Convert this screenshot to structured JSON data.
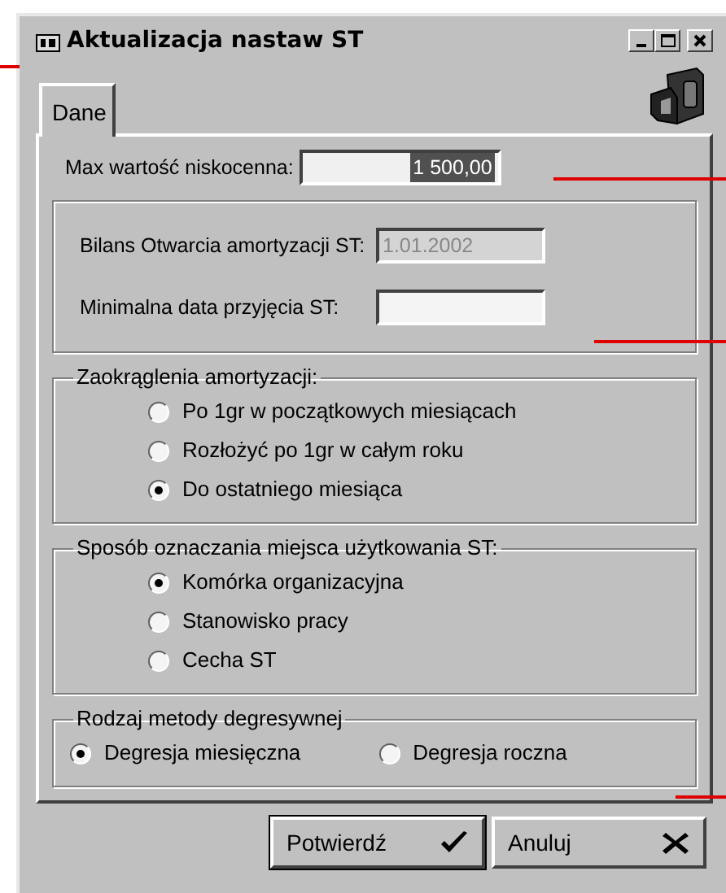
{
  "window": {
    "title": "Aktualizacja nastaw ST"
  },
  "tabs": [
    {
      "label": "Dane",
      "selected": true
    }
  ],
  "max_field": {
    "label": "Max wartość niskocenna:",
    "value": "1 500,00",
    "value_selected": true
  },
  "date_fields": [
    {
      "label": "Bilans Otwarcia amortyzacji ST:",
      "value": "1.01.2002",
      "disabled": true
    },
    {
      "label": "Minimalna data przyjęcia ST:",
      "disabled": false
    }
  ],
  "groups": [
    {
      "title": "Zaokrąglenia amortyzacji:",
      "options": [
        {
          "label": "Po 1gr w początkowych miesiącach",
          "selected": false
        },
        {
          "label": "Rozłożyć po 1gr w całym roku",
          "selected": false
        },
        {
          "label": "Do ostatniego miesiąca",
          "selected": true
        }
      ]
    },
    {
      "title": "Sposób oznaczania miejsca użytkowania ST:",
      "options": [
        {
          "label": "Komórka organizacyjna",
          "selected": true
        },
        {
          "label": "Stanowisko pracy",
          "selected": false
        },
        {
          "label": "Cecha ST",
          "selected": false
        }
      ]
    },
    {
      "title": "Rodzaj metody degresywnej",
      "options": [
        {
          "label": "Degresja miesięczna",
          "selected": true
        },
        {
          "label": "Degresja roczna",
          "selected": false
        }
      ]
    }
  ],
  "buttons": [
    {
      "label": "Potwierdź",
      "kind": "confirm"
    },
    {
      "label": "Anuluj",
      "kind": "cancel"
    }
  ]
}
